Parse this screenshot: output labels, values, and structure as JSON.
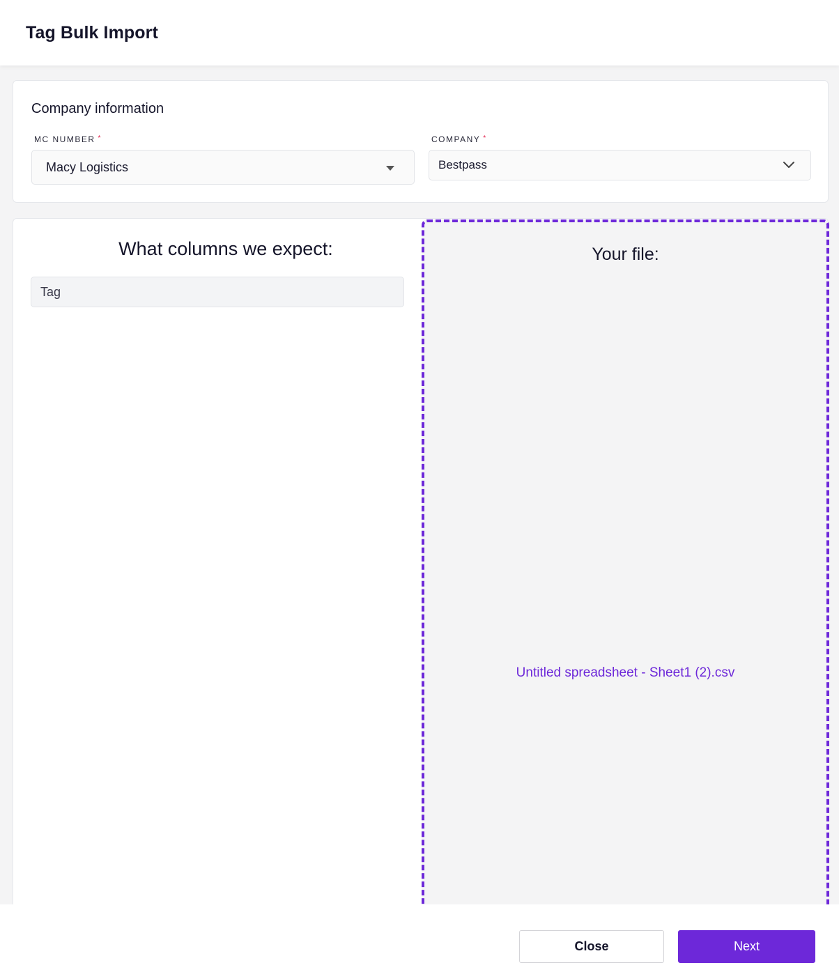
{
  "header": {
    "title": "Tag Bulk Import"
  },
  "company_info": {
    "title": "Company information",
    "mc_number": {
      "label": "MC NUMBER",
      "required_mark": "*",
      "value": "Macy Logistics"
    },
    "company": {
      "label": "COMPANY",
      "required_mark": "*",
      "value": "Bestpass"
    }
  },
  "columns": {
    "expect_title": "What columns we expect:",
    "expected": [
      "Tag"
    ]
  },
  "upload": {
    "title": "Your file:",
    "file_name": "Untitled spreadsheet - Sheet1 (2).csv",
    "accent_color": "#6d28d9"
  },
  "footer": {
    "close_label": "Close",
    "next_label": "Next"
  },
  "icons": {
    "mc_number_dropdown": "caret-down-icon",
    "company_dropdown": "chevron-down-icon"
  }
}
